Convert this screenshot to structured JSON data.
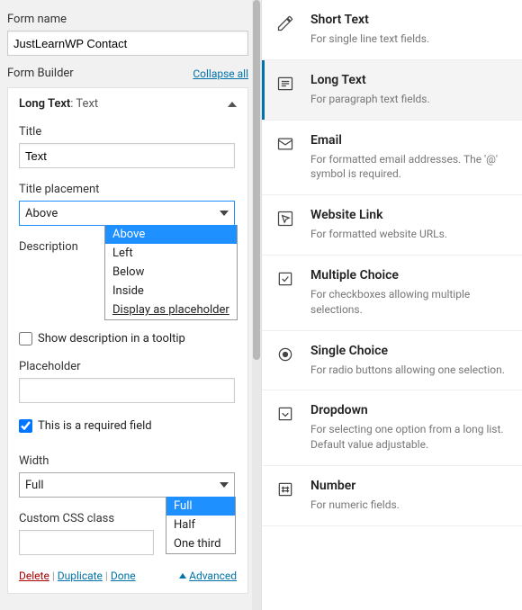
{
  "left": {
    "form_name_label": "Form name",
    "form_name_value": "JustLearnWP Contact",
    "builder_title": "Form Builder",
    "collapse_all": "Collapse all",
    "panel_title_strong": "Long Text",
    "panel_title_suffix": ": Text",
    "title_label": "Title",
    "title_value": "Text",
    "placement_label": "Title placement",
    "placement_value": "Above",
    "placement_options": [
      "Above",
      "Left",
      "Below",
      "Inside",
      "Display as placeholder"
    ],
    "description_label": "Description",
    "show_tooltip": "Show description in a tooltip",
    "placeholder_label": "Placeholder",
    "required_label": "This is a required field",
    "width_label": "Width",
    "width_value": "Full",
    "width_options": [
      "Full",
      "Half",
      "One third"
    ],
    "css_label": "Custom CSS class",
    "delete": "Delete",
    "duplicate": "Duplicate",
    "done": "Done",
    "advanced": "Advanced"
  },
  "right": {
    "items": [
      {
        "name": "Short Text",
        "desc": "For single line text fields."
      },
      {
        "name": "Long Text",
        "desc": "For paragraph text fields."
      },
      {
        "name": "Email",
        "desc": "For formatted email addresses. The '@' symbol is required."
      },
      {
        "name": "Website Link",
        "desc": "For formatted website URLs."
      },
      {
        "name": "Multiple Choice",
        "desc": "For checkboxes allowing multiple selections."
      },
      {
        "name": "Single Choice",
        "desc": "For radio buttons allowing one selection."
      },
      {
        "name": "Dropdown",
        "desc": "For selecting one option from a long list. Default value adjustable."
      },
      {
        "name": "Number",
        "desc": "For numeric fields."
      }
    ]
  }
}
